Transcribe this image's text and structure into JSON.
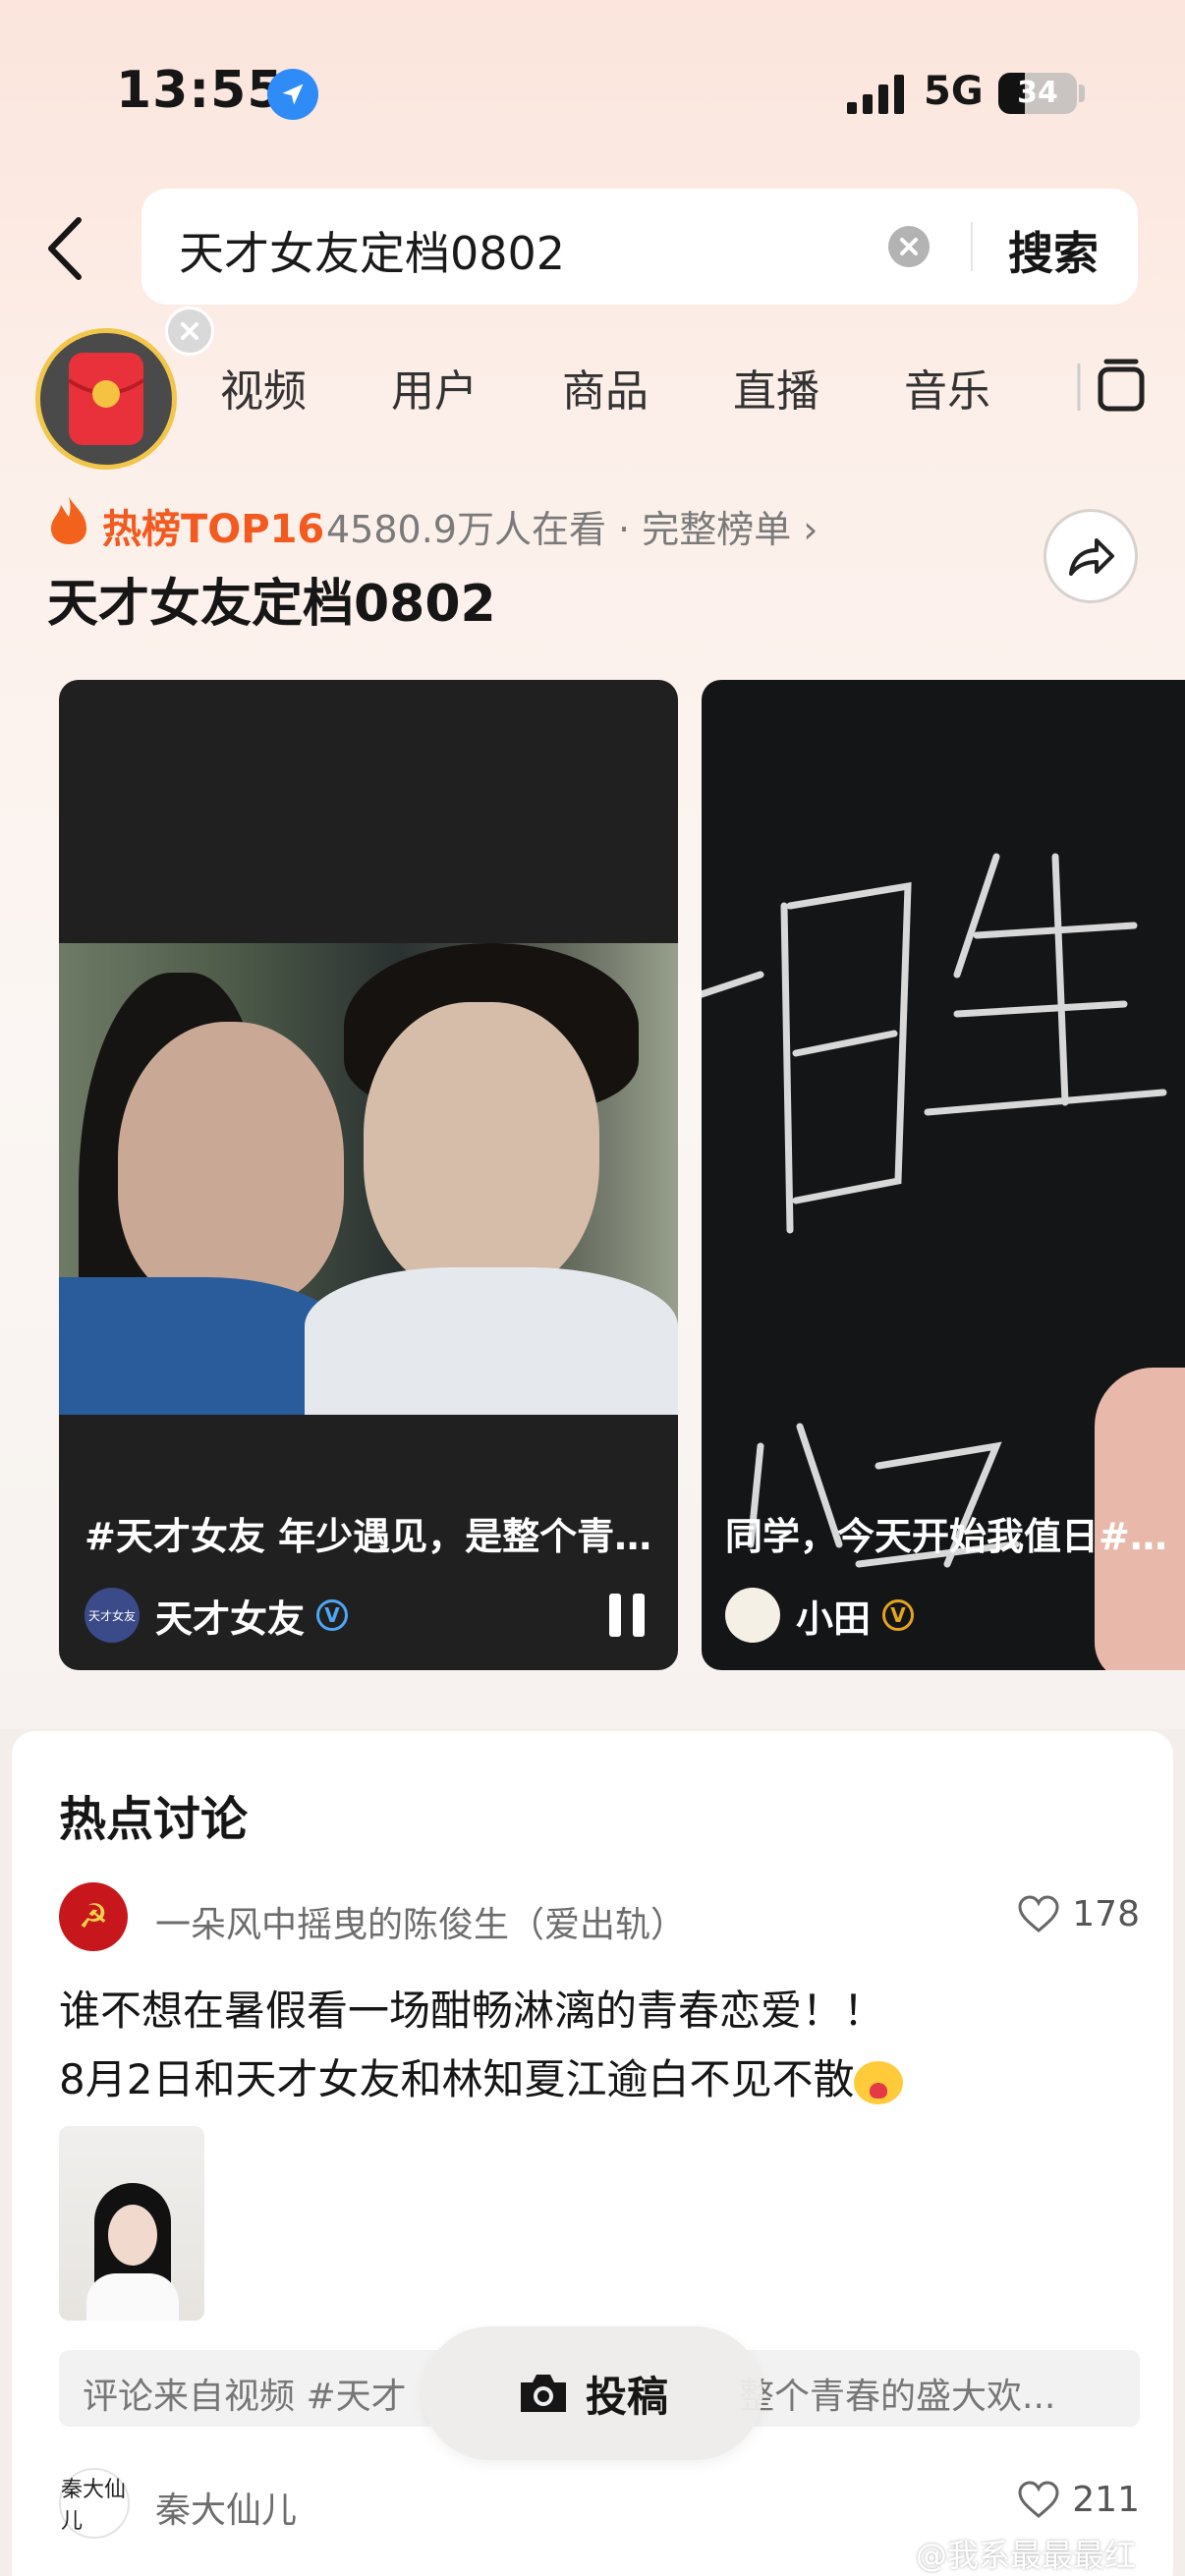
{
  "status_bar": {
    "time": "13:55",
    "network": "5G",
    "battery": "34",
    "battery_percent": 34
  },
  "search": {
    "query": "天才女友定档0802",
    "button": "搜索"
  },
  "tabs": [
    "视频",
    "用户",
    "商品",
    "直播",
    "音乐"
  ],
  "hot": {
    "rank_label": "热榜TOP16",
    "meta": "4580.9万人在看 · 完整榜单 ›",
    "title": "天才女友定档0802"
  },
  "videos": [
    {
      "caption": "#天才女友 年少遇见，是整个青...",
      "author": "天才女友",
      "avatar_text": "天才女友"
    },
    {
      "caption": "同学，今天开始我值日#天才",
      "author": "小田"
    }
  ],
  "discussion": {
    "title": "热点讨论",
    "posts": [
      {
        "author": "一朵风中摇曳的陈俊生（爱出轨）",
        "likes": "178",
        "line1": "谁不想在暑假看一场酣畅淋漓的青春恋爱！！",
        "line2": "8月2日和天才女友和林知夏江逾白不见不散",
        "source_left": "评论来自视频 #天才",
        "source_right": "整个青春的盛大欢..."
      },
      {
        "author": "秦大仙儿",
        "likes": "211",
        "avatar_text": "秦大仙儿"
      }
    ]
  },
  "post_button": "投稿",
  "watermark": "@我系最最最红",
  "colors": {
    "accent": "#f25a1f",
    "verified_blue": "#2f8bf5",
    "verified_gold": "#e3a420"
  }
}
